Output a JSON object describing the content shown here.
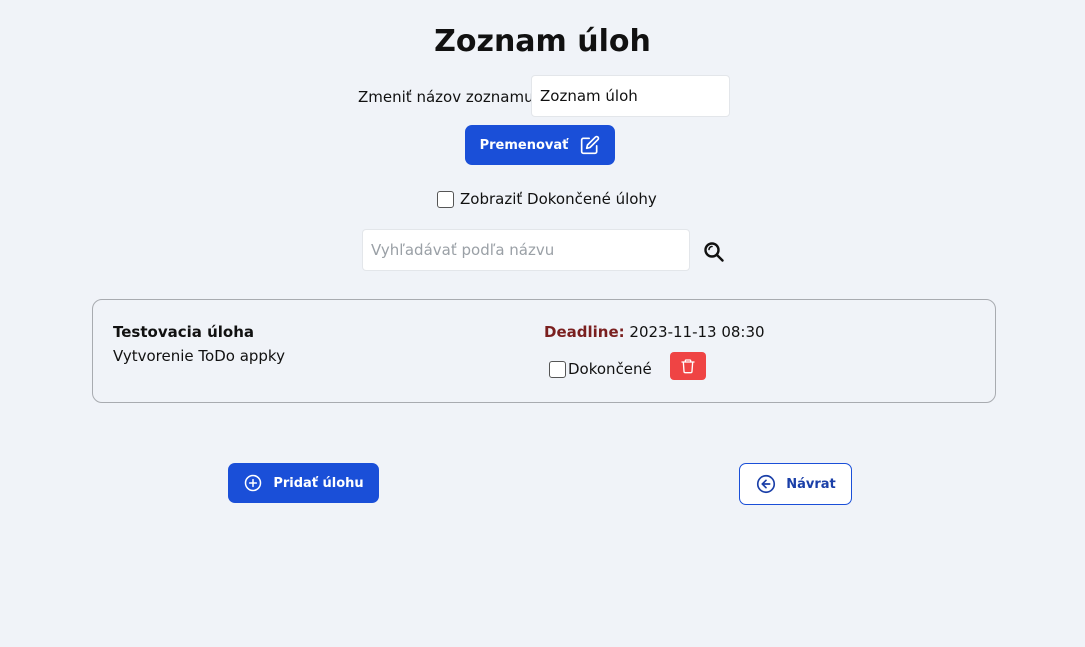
{
  "page": {
    "title": "Zoznam úloh"
  },
  "rename": {
    "label": "Zmeniť názov zoznamu:",
    "value": "Zoznam úloh",
    "button_label": "Premenovať",
    "button_icon": "edit-icon"
  },
  "filters": {
    "show_completed_label": "Zobraziť Dokončené úlohy",
    "show_completed_checked": false,
    "search_placeholder": "Vyhľadávať podľa názvu",
    "search_value": "",
    "search_icon": "search-icon"
  },
  "tasks": [
    {
      "title": "Testovacia úloha",
      "description": "Vytvorenie ToDo appky",
      "deadline_label": "Deadline:",
      "deadline_value": "2023-11-13 08:30",
      "done_label": "Dokončené",
      "done_checked": false,
      "delete_icon": "trash-icon"
    }
  ],
  "actions": {
    "add_label": "Pridať úlohu",
    "add_icon": "plus-circle-icon",
    "back_label": "Návrat",
    "back_icon": "arrow-left-circle-icon"
  },
  "colors": {
    "background": "#f0f3f8",
    "primary": "#1a4fd8",
    "danger": "#ef4444",
    "deadline_label": "#7a1f1f"
  }
}
